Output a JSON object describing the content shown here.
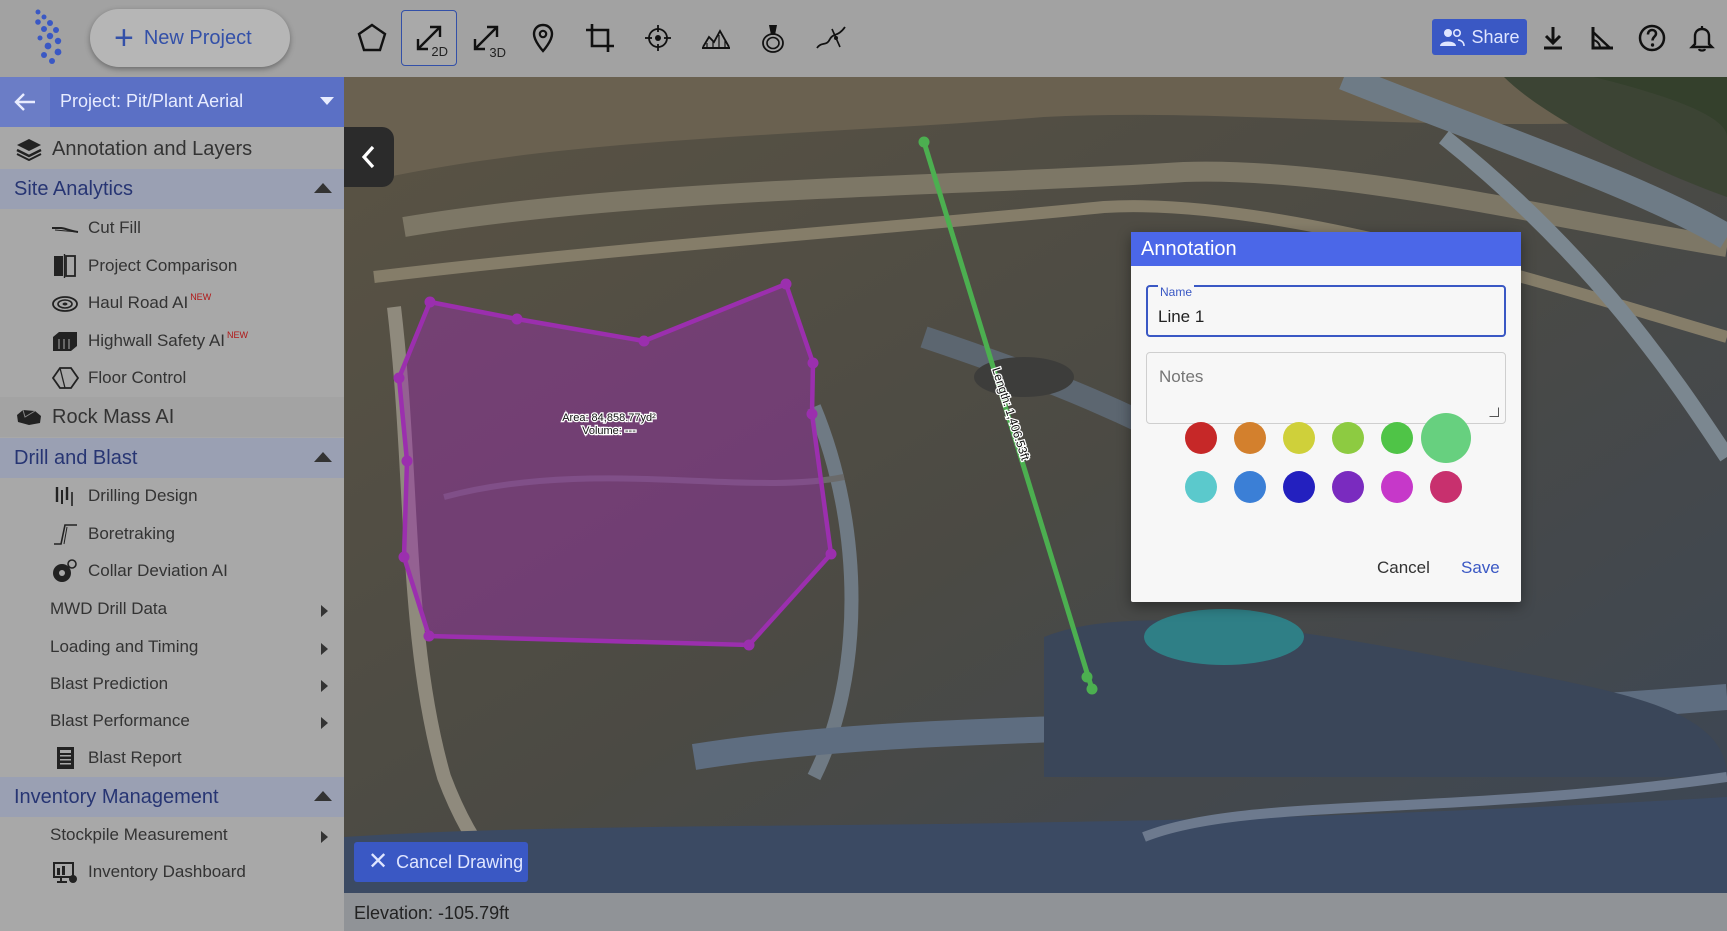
{
  "toolbar": {
    "new_project_label": "New Project",
    "tool_2d_sub": "2D",
    "tool_3d_sub": "3D",
    "share_label": "Share"
  },
  "sidebar": {
    "project_label": "Project: Pit/Plant Aerial",
    "annotation_layers": "Annotation and Layers",
    "site_analytics": {
      "title": "Site Analytics",
      "items": [
        "Cut Fill",
        "Project Comparison",
        "Haul Road AI",
        "Highwall Safety AI",
        "Floor Control"
      ]
    },
    "new_tag": "NEW",
    "rock_mass": "Rock Mass AI",
    "drill_blast": {
      "title": "Drill and Blast",
      "items": [
        "Drilling Design",
        "Boretraking",
        "Collar Deviation AI",
        "MWD Drill Data",
        "Loading and Timing",
        "Blast Prediction",
        "Blast Performance",
        "Blast Report"
      ]
    },
    "inventory": {
      "title": "Inventory Management",
      "items": [
        "Stockpile Measurement",
        "Inventory Dashboard"
      ]
    }
  },
  "map": {
    "area_label": "Area: 84,858.77yd²",
    "volume_label": "Volume: ---",
    "length_label": "Length: 1,406.53ft",
    "polygon_color": "#9b2fae",
    "line_color": "#4caf50",
    "cancel_drawing_label": "Cancel Drawing",
    "elevation_label": "Elevation: -105.79ft"
  },
  "dialog": {
    "title": "Annotation",
    "name_label": "Name",
    "name_value": "Line 1",
    "notes_placeholder": "Notes",
    "colors": [
      "#c62828",
      "#d3802d",
      "#cfd03a",
      "#8dcb41",
      "#4fc447",
      "#67d07f",
      "#5bc9cc",
      "#3b7fd6",
      "#2320bf",
      "#7a2bbf",
      "#c638c9",
      "#c8306e"
    ],
    "selected_color": "#67d07f",
    "cancel_label": "Cancel",
    "save_label": "Save"
  }
}
